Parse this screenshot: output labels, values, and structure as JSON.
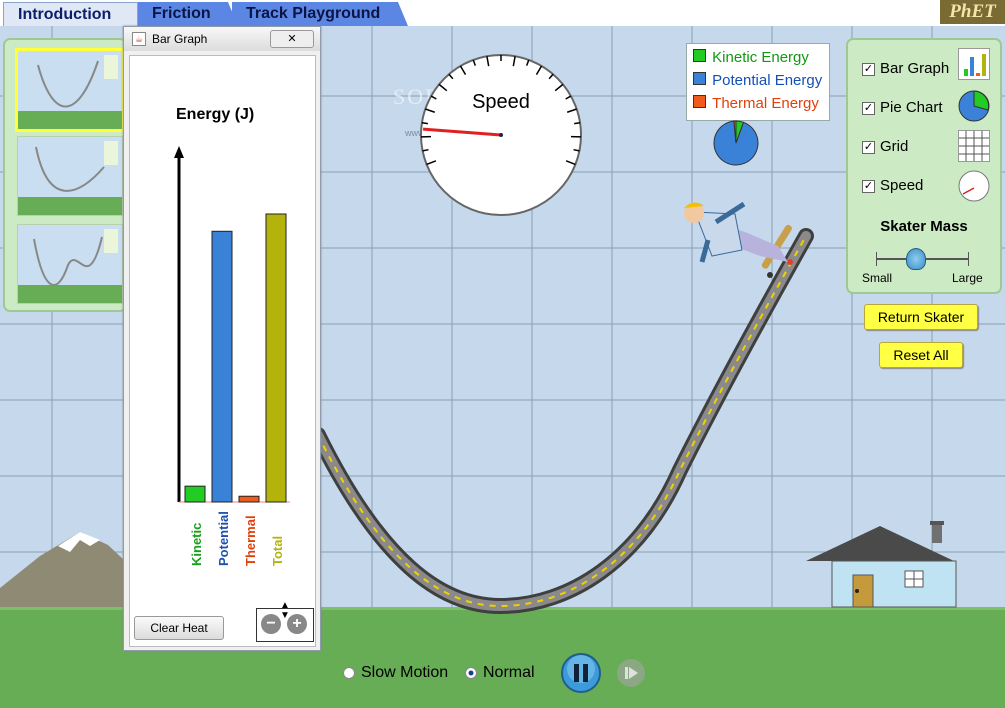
{
  "tabs": [
    {
      "label": "Introduction",
      "active": true
    },
    {
      "label": "Friction",
      "active": false
    },
    {
      "label": "Track Playground",
      "active": false
    }
  ],
  "logo": "PhET",
  "watermark": "SOFTPEDIA",
  "watermark_small": "www.softpedia.com",
  "bar_graph": {
    "window_title": "Bar Graph",
    "close_symbol": "✕",
    "axis_label": "Energy (J)",
    "clear_heat_label": "Clear Heat",
    "zoom_out_symbol": "−",
    "zoom_in_symbol": "+",
    "bars": [
      {
        "label": "Kinetic",
        "value": 0.055,
        "color": "#22cc22",
        "label_color": "#1a9f1a"
      },
      {
        "label": "Potential",
        "value": 0.94,
        "color": "#3a82d8",
        "label_color": "#1b4fb0"
      },
      {
        "label": "Thermal",
        "value": 0.02,
        "color": "#f05a1a",
        "label_color": "#e0400c"
      },
      {
        "label": "Total",
        "value": 1.0,
        "color": "#b3b30c",
        "label_color": "#b3b30c"
      }
    ]
  },
  "speedometer": {
    "label": "Speed",
    "needle_fraction": 0.03
  },
  "legend": {
    "items": [
      {
        "label": "Kinetic Energy",
        "color": "#22cc22",
        "text_color": "#109910"
      },
      {
        "label": "Potential Energy",
        "color": "#3a82d8",
        "text_color": "#1450b4"
      },
      {
        "label": "Thermal Energy",
        "color": "#f05a1a",
        "text_color": "#e0400c"
      }
    ]
  },
  "pie_chart": {
    "kinetic": 0.055,
    "potential": 0.93,
    "thermal": 0.015
  },
  "controls": {
    "checkboxes": [
      {
        "label": "Bar Graph",
        "checked": true,
        "icon": "bar-graph-icon"
      },
      {
        "label": "Pie Chart",
        "checked": true,
        "icon": "pie-chart-icon"
      },
      {
        "label": "Grid",
        "checked": true,
        "icon": "grid-icon"
      },
      {
        "label": "Speed",
        "checked": true,
        "icon": "speed-icon"
      }
    ],
    "check_symbol": "✓",
    "skater_mass_title": "Skater Mass",
    "mass_min_label": "Small",
    "mass_max_label": "Large",
    "mass_value": 0.42
  },
  "buttons": {
    "return_skater": "Return Skater",
    "reset_all": "Reset All"
  },
  "playback": {
    "slow_motion_label": "Slow Motion",
    "normal_label": "Normal",
    "selected": "Normal"
  },
  "colors": {
    "sky": "#c6d9ec",
    "grass": "#67ad55",
    "panel": "#ccebc4",
    "button_yellow": "#ffff44"
  }
}
